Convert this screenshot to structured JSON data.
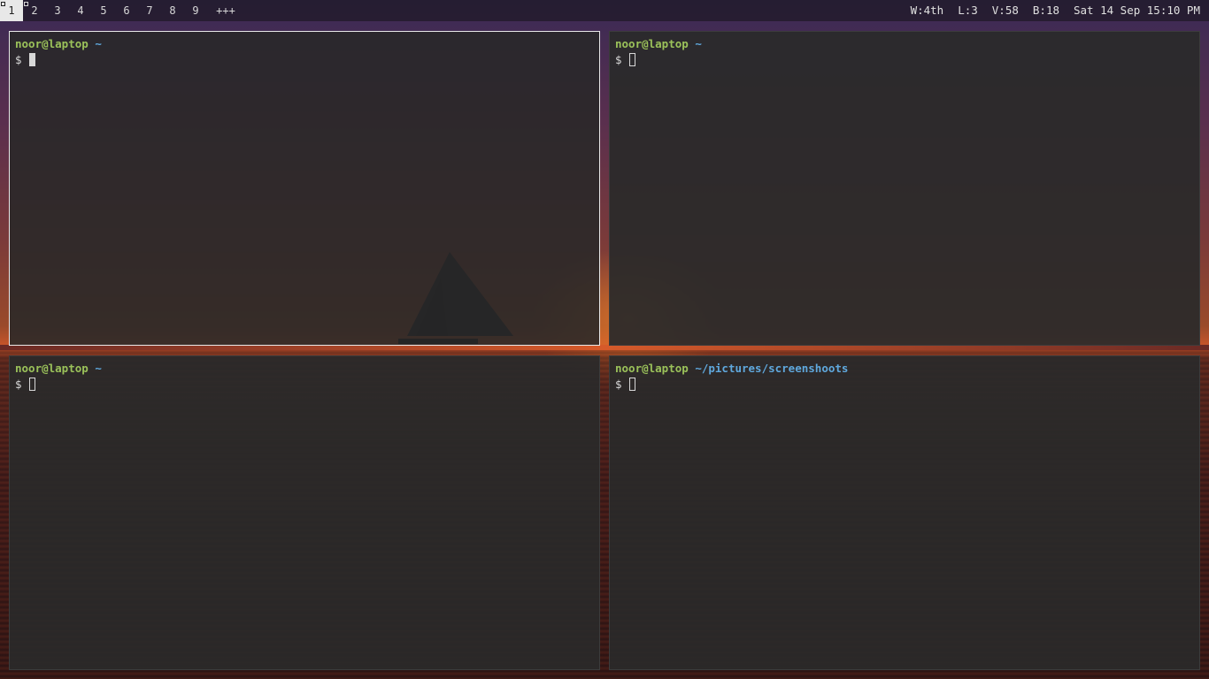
{
  "topbar": {
    "workspaces": [
      "1",
      "2",
      "3",
      "4",
      "5",
      "6",
      "7",
      "8",
      "9",
      "+++"
    ],
    "active_workspace": "1",
    "status": {
      "workspace": "W:4th",
      "layout": "L:3",
      "volume": "V:58",
      "brightness": "B:18",
      "clock": "Sat 14 Sep 15:10 PM"
    }
  },
  "terminals": [
    {
      "user_host": "noor@laptop",
      "path": "~",
      "prompt": "$",
      "focused": true
    },
    {
      "user_host": "noor@laptop",
      "path": "~",
      "prompt": "$",
      "focused": false
    },
    {
      "user_host": "noor@laptop",
      "path": "~",
      "prompt": "$",
      "focused": false
    },
    {
      "user_host": "noor@laptop",
      "path": "~/pictures/screenshoots",
      "prompt": "$",
      "focused": false
    }
  ],
  "colors": {
    "user_host": "#9bc25a",
    "path": "#5fa8dd",
    "focused_border": "#e8e8e8"
  }
}
